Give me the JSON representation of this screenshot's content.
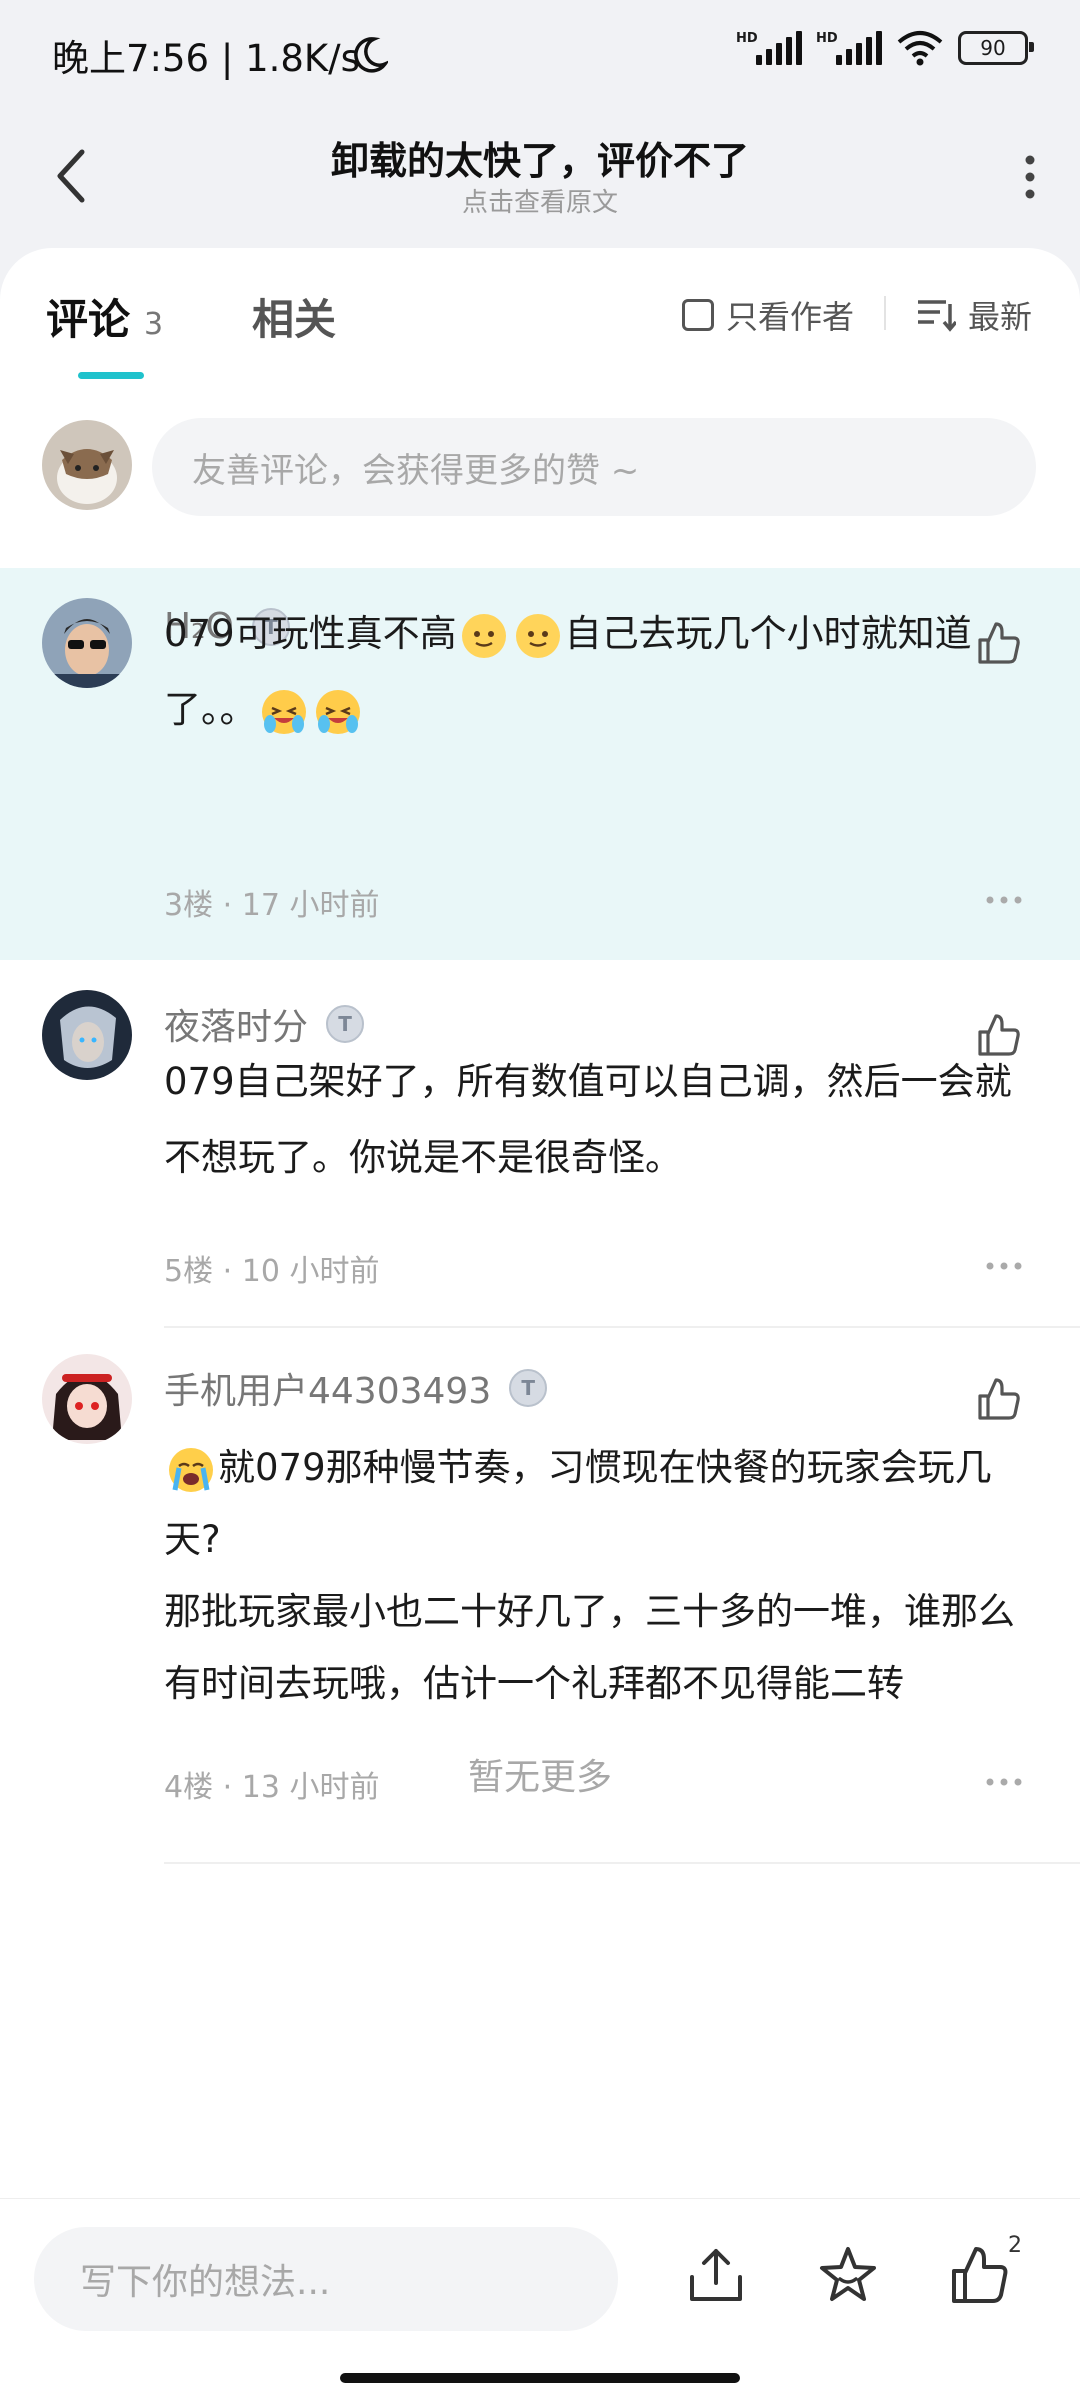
{
  "status_bar": {
    "time": "晚上7:56 | 1.8K/s",
    "hd1": "HD",
    "hd2": "HD",
    "battery": "90"
  },
  "header": {
    "title": "卸载的太快了，评价不了",
    "subtitle": "点击查看原文"
  },
  "tabs": {
    "comments_label": "评论",
    "comments_count": "3",
    "related_label": "相关",
    "author_only": "只看作者",
    "sort": "最新",
    "accent": "#1fc2cc"
  },
  "composer": {
    "placeholder": "友善评论，会获得更多的赞 ~"
  },
  "comments": [
    {
      "user": "H₂O",
      "badge": "T",
      "line1": "079可玩性真不高",
      "line1b": "自己去玩几个小时就知道",
      "line2": "了。。",
      "floor": "3楼",
      "time": "17 小时前"
    },
    {
      "user": "夜落时分",
      "badge": "T",
      "text": "079自己架好了，所有数值可以自己调，然后一会就不想玩了。你说是不是很奇怪。",
      "floor": "5楼",
      "time": "10 小时前"
    },
    {
      "user": "手机用户44303493",
      "badge": "T",
      "p1": "就079那种慢节奏，习惯现在快餐的玩家会玩几天?",
      "p2": "那批玩家最小也二十好几了，三十多的一堆，谁那么有时间去玩哦，估计一个礼拜都不见得能二转",
      "floor": "4楼",
      "time": "13 小时前"
    }
  ],
  "meta_sep": "·",
  "no_more": "暂无更多",
  "bottom_bar": {
    "placeholder": "写下你的想法...",
    "like_count": "2"
  }
}
